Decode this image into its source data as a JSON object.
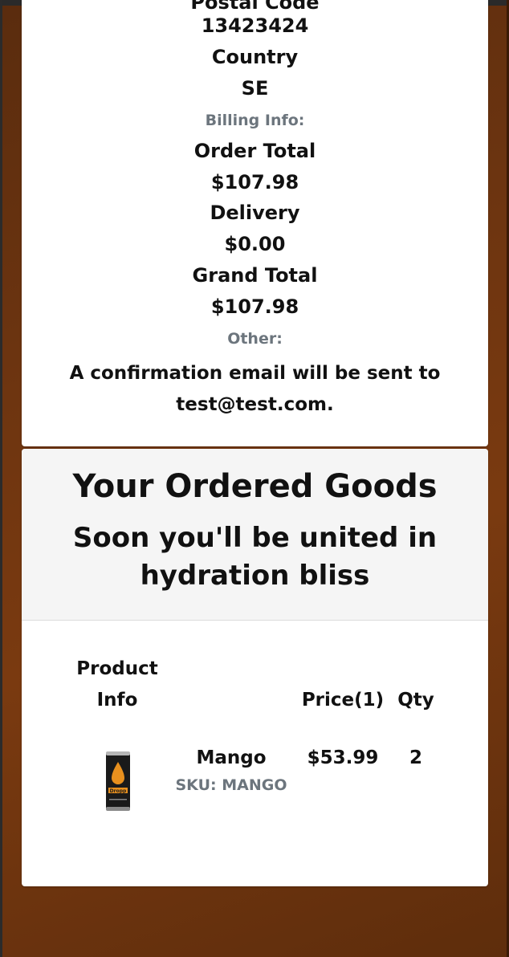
{
  "partial_top_label": "Postal Code",
  "shipping": {
    "postal_code_value": "13423424",
    "country_label": "Country",
    "country_value": "SE"
  },
  "billing": {
    "section_label": "Billing Info:",
    "order_total_label": "Order Total",
    "order_total_value": "$107.98",
    "delivery_label": "Delivery",
    "delivery_value": "$0.00",
    "grand_total_label": "Grand Total",
    "grand_total_value": "$107.98"
  },
  "other": {
    "section_label": "Other:",
    "confirmation_text": "A confirmation email will be sent to test@test.com."
  },
  "goods": {
    "title": "Your Ordered Goods",
    "subtitle": "Soon you'll be united in hydration bliss",
    "columns": {
      "product_info": "Product Info",
      "price": "Price(1)",
      "qty": "Qty"
    },
    "items": [
      {
        "name": "Mango",
        "sku": "SKU: MANGO",
        "price": "$53.99",
        "qty": "2",
        "image_icon": "drink-can-image",
        "image_text": "Dropp"
      }
    ]
  }
}
